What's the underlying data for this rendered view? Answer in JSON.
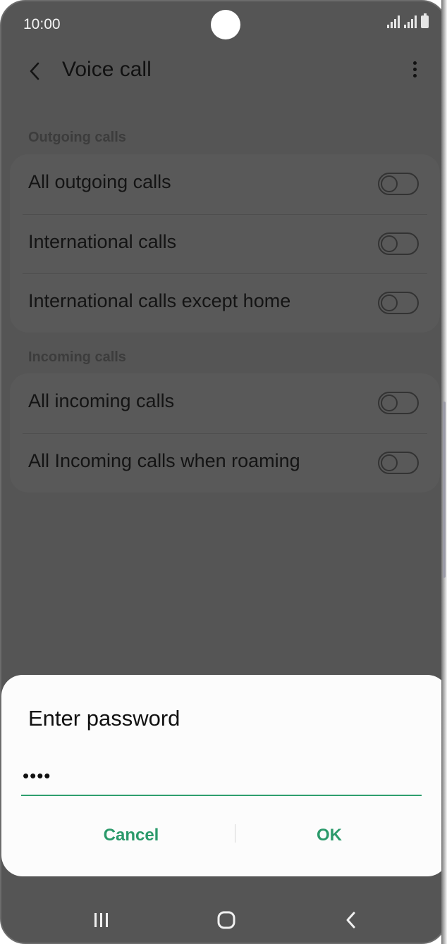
{
  "status_bar": {
    "time": "10:00"
  },
  "header": {
    "title": "Voice call",
    "back_icon": "chevron-left-icon",
    "more_icon": "more-vert-icon"
  },
  "sections": [
    {
      "label": "Outgoing calls",
      "items": [
        {
          "label": "All outgoing calls",
          "on": false
        },
        {
          "label": "International calls",
          "on": false
        },
        {
          "label": "International calls except home",
          "on": false
        }
      ]
    },
    {
      "label": "Incoming calls",
      "items": [
        {
          "label": "All incoming calls",
          "on": false
        },
        {
          "label": "All Incoming calls when roaming",
          "on": false
        }
      ]
    }
  ],
  "dialog": {
    "title": "Enter password",
    "input_value": "••••",
    "cancel_label": "Cancel",
    "ok_label": "OK"
  },
  "colors": {
    "accent": "#2b9a6b",
    "scrim": "#555555",
    "dialog_bg": "#fcfcfc"
  }
}
